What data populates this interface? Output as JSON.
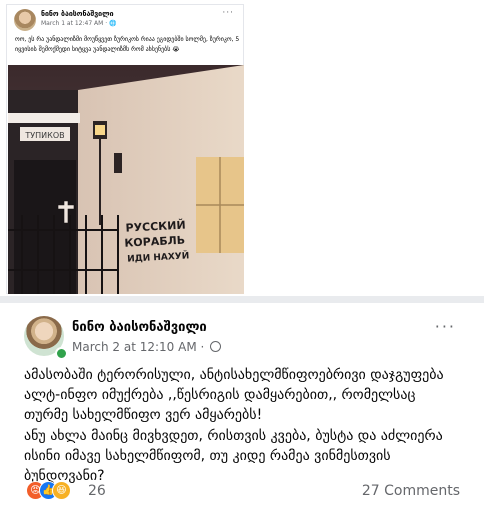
{
  "top_post": {
    "author": "ნინო ბაისონაშვილი",
    "meta": "March 1 at 12:47 AM · 🌐",
    "more_label": "···",
    "text": "ოო, ეს რა  უანდალიზმი მოუწყვეთ ზურიკოს რიაა ეგიდებში სოლმე, ზურიკო, 5 იყვისის შემოქმედი სიტყვა უანდალიზმს რომ ახსენებს 😭",
    "photo": {
      "description_signs": [
        "ТУПИКОВ",
        "РУССКИЙ",
        "КОРАБЛЬ",
        "ИДИ НАХУЙ"
      ]
    }
  },
  "main_post": {
    "author": "ნინო ბაისონაშვილი",
    "timestamp": "March 2 at 12:10 AM",
    "separator": "·",
    "more_label": "···",
    "lines": [
      "ამასობაში ტერორისული, ანტისახელმწიფოებრივი დაჯგუფება",
      "ალტ-ინფო იმუქრება ,,წესრიგის დამყარებით,, რომელსაც",
      "თურმე სახელმწიფო ვერ ამყარებს!",
      "ანუ ახლა მაინც მივხვდეთ, რისთვის კვება, ბუსტა და აძლიერა",
      "ისინი იმავე სახელმწიფომ,  თუ კიდე რამეა ვინმესთვის",
      "ბუნდოვანი?"
    ],
    "reaction_count": "26",
    "comments_label": "27 Comments",
    "reactions": [
      "angry-icon",
      "like-icon",
      "haha-icon"
    ]
  }
}
